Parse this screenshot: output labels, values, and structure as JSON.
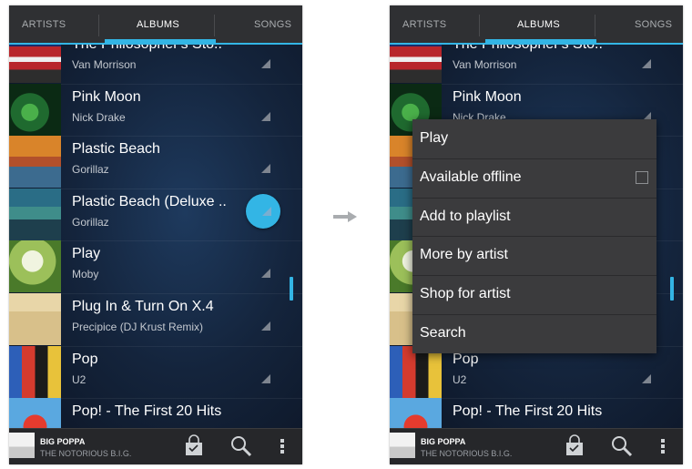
{
  "tabs": [
    "ARTISTS",
    "ALBUMS",
    "SONGS"
  ],
  "albums": [
    {
      "title": "The Philosopher's Sto..",
      "artist": "Van Morrison"
    },
    {
      "title": "Pink Moon",
      "artist": "Nick Drake"
    },
    {
      "title": "Plastic Beach",
      "artist": "Gorillaz"
    },
    {
      "title": "Plastic Beach (Deluxe ..",
      "artist": "Gorillaz"
    },
    {
      "title": "Play",
      "artist": "Moby"
    },
    {
      "title": "Plug In & Turn On X.4",
      "artist": "Precipice (DJ Krust Remix)"
    },
    {
      "title": "Pop",
      "artist": "U2"
    },
    {
      "title": "Pop!  - The First 20 Hits",
      "artist": ""
    }
  ],
  "now_playing": {
    "title": "BIG POPPA",
    "artist": "THE NOTORIOUS B.I.G."
  },
  "context_menu": {
    "play": "Play",
    "available_offline": "Available offline",
    "add_to_playlist": "Add to playlist",
    "more_by_artist": "More by artist",
    "shop_for_artist": "Shop for artist",
    "search": "Search"
  },
  "icons": {
    "shop": "shopping-bag-icon",
    "search": "search-icon",
    "overflow": "overflow-menu-icon",
    "arrow": "right-arrow-icon"
  },
  "colors": {
    "accent": "#33b5e5",
    "tabbar": "#2f3033",
    "menu": "#3b3b3d"
  }
}
